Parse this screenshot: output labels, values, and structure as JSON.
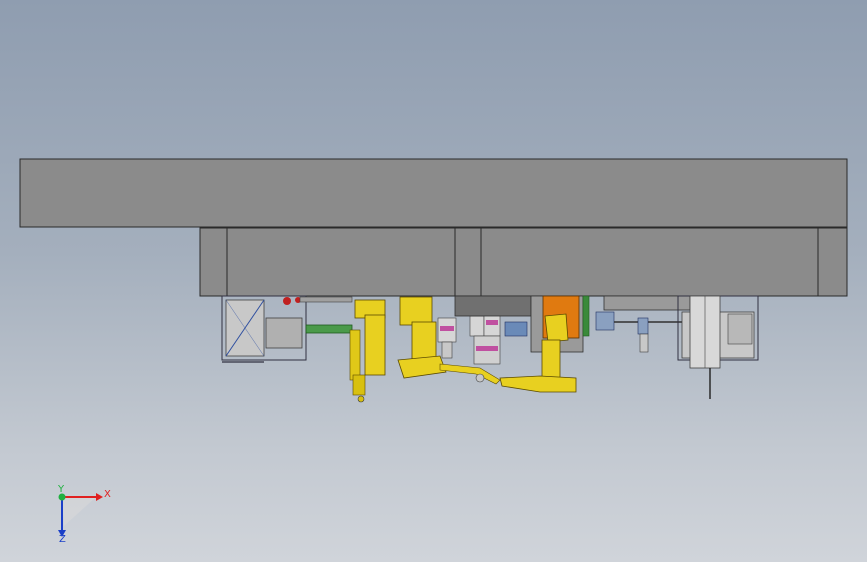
{
  "view": {
    "triad": {
      "x_axis_label": "X",
      "y_axis_label": "Y",
      "z_axis_label": "Z",
      "x_color": "#e02020",
      "y_color": "#20b040",
      "z_color": "#1a3fc8"
    },
    "colors": {
      "housing": "#8b8b8b",
      "housing_edge": "#2a2a2a",
      "robot_yellow": "#e8d020",
      "robot_orange": "#e07a10",
      "accent_magenta": "#c050a0",
      "accent_green": "#3a9a3a",
      "accent_blue": "#3060c0",
      "accent_red": "#c02020"
    }
  }
}
